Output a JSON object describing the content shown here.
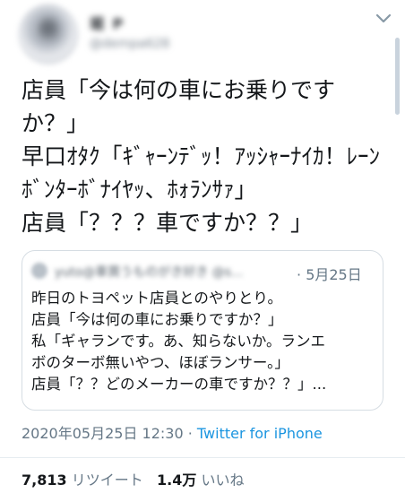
{
  "author": {
    "name": "堀 P",
    "handle": "@dempa628"
  },
  "tweet": {
    "lines": [
      "店員「今は何の車にお乗りですか？」",
      "早口ｵﾀｸ「ｷﾞｬｰﾝﾃﾞｯ！ｱｯｼｬｰﾅｲｶ！ﾚｰﾝﾎﾞﾝﾀｰﾎﾞﾅｲﾔｯ、ﾎｫﾗﾝｻｧ」",
      "店員「？？？車ですか？？」"
    ]
  },
  "quote": {
    "user": "yuto@車買うものがき好き @s...",
    "separator": "·",
    "date": "5月25日",
    "lines": [
      "昨日のトヨペット店員とのやりとり。",
      "店員「今は何の車にお乗りですか？」",
      "私「ギャランです。あ、知らないか。ランエ",
      "ボのターボ無いやつ、ほぼランサー。」",
      "店員「？？どのメーカーの車ですか？？」..."
    ]
  },
  "meta": {
    "timestamp": "2020年05月25日 12:30",
    "separator": "·",
    "source": "Twitter for iPhone"
  },
  "stats": {
    "retweets_count": "7,813",
    "retweets_label": "リツイート",
    "likes_count": "1.4万",
    "likes_label": "いいね"
  },
  "icons": {
    "more": "chevron-down-icon"
  },
  "colors": {
    "text": "#14171a",
    "secondary": "#657786",
    "link": "#1b95e0",
    "border": "#d6dde3"
  }
}
